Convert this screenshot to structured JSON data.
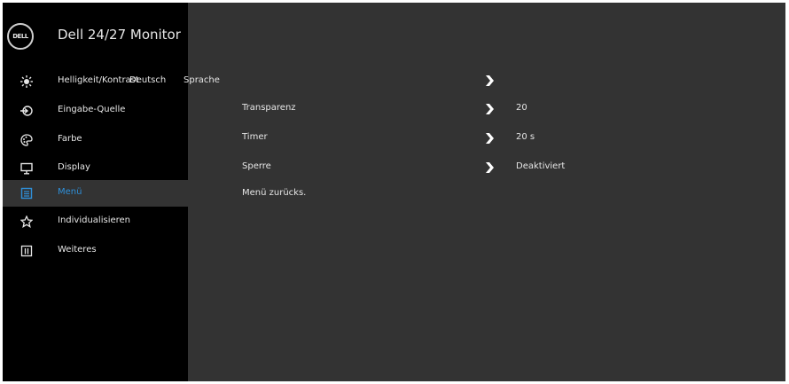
{
  "header": {
    "logo_text": "DELL",
    "title": "Dell 24/27 Monitor"
  },
  "sidebar": {
    "items": [
      {
        "label": "Helligkeit/Kontrast",
        "icon": "brightness-icon"
      },
      {
        "label": "Eingabe-Quelle",
        "icon": "input-source-icon"
      },
      {
        "label": "Farbe",
        "icon": "color-palette-icon"
      },
      {
        "label": "Display",
        "icon": "display-icon"
      },
      {
        "label": "Menü",
        "icon": "menu-icon",
        "selected": true
      },
      {
        "label": "Individualisieren",
        "icon": "star-icon"
      },
      {
        "label": "Weiteres",
        "icon": "info-icon"
      }
    ]
  },
  "main": {
    "options": [
      {
        "label": "Sprache",
        "value": "Deutsch"
      },
      {
        "label": "Transparenz",
        "value": "20"
      },
      {
        "label": "Timer",
        "value": "20 s"
      },
      {
        "label": "Sperre",
        "value": "Deaktiviert"
      },
      {
        "label": "Menü zurücks.",
        "value": ""
      }
    ]
  },
  "colors": {
    "selected_text": "#2f8fd8",
    "panel": "#333333",
    "sidebar": "#000000",
    "text": "#e6e6e6"
  }
}
